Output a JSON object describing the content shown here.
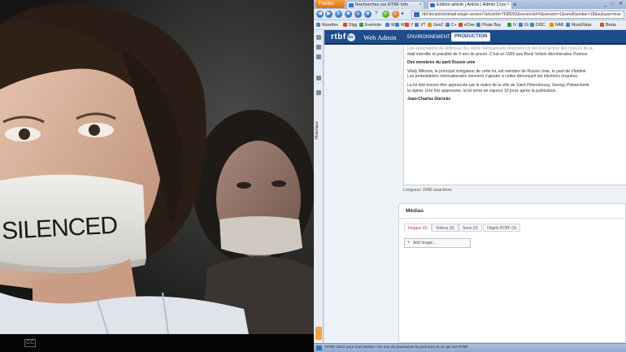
{
  "video": {
    "sign_text": "SILENCED",
    "control_label": "CC"
  },
  "browser": {
    "app_button": "Firefox",
    "tabs": [
      {
        "label": "Recherches sur RTBF Info",
        "active": false
      },
      {
        "label": "Edition article | Article | Admin Cryo",
        "active": true
      }
    ],
    "new_tab": "+",
    "window_controls": "_ □ ✕",
    "url": "rtbf.be/article/detail-single-version?articleId=7698282&versionId=5&version=1&sendNumber=18&subuser=true",
    "bookmarks": [
      "Rosettes",
      "Digg",
      "Evernote",
      "W",
      "W",
      "Y",
      "VT",
      "GeoZ",
      "C+",
      "eCine",
      "Pirate Bay",
      "IV",
      "IG",
      "DiSC",
      "NAB",
      "MusicNinja",
      "Besta"
    ],
    "sidebar_label": "Historique"
  },
  "cms": {
    "logo": "rtbf",
    "logo_badge": "be",
    "app_title": "Web Admin",
    "env_label": "ENVIRONNEMENT",
    "env_value": "PRODUCTION",
    "article": {
      "intro_faded": "Les associations de défenses des droits homosexuels déplorent un recul en arrière des moeurs de la",
      "intro_line2": "était interdite et passible de 5 ans de prison. C'est en 1993 que Boris Yeltsin décriminalise l'homos",
      "heading": "Des membres du parti Russie unie",
      "p1_line1": "Vitaly Milonov, le principal instigateur de cette loi, est membre de Russie Unie, le parti de Vladimir",
      "p1_line2": "Les protestations internationales viennent s'ajouter à celles dénonçant les élections truquées.",
      "p2_line1": "La loi doit encore être approuvée par le maire de la ville de Saint-Pétersbourg, Georgy Poltavchenk",
      "p2_line2": "la signer. Une fois approuvée, la loi entre en vigueur 10 jours après la publication.",
      "author": "Jean-Charles Dierickx"
    },
    "char_count": "Longueur: 2048 caractères",
    "media": {
      "title": "Médias",
      "tabs": [
        "Images (0)",
        "Vidéos (0)",
        "Sons (0)",
        "Objets RTBF (0)"
      ],
      "add_label": "Add Image..."
    }
  },
  "status_text": "RTBF 2012 pour tout besoin • En vue de poursuivre le parcours et ce qui est RTBF",
  "colors": {
    "rtbf_header": "#1d4c8a",
    "firefox_button": "#dd6f12",
    "link_red": "#b4372b"
  }
}
